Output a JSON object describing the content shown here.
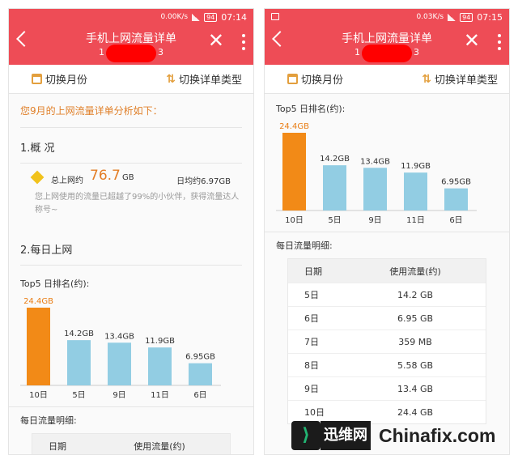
{
  "header": {
    "title": "手机上网流量详单",
    "subtitle_left": "1",
    "subtitle_right": "3",
    "close_glyph": "✕"
  },
  "left_status": {
    "speed": "0.00K/s",
    "battery": "94",
    "time": "07:14"
  },
  "right_status": {
    "speed": "0.03K/s",
    "battery": "94",
    "time": "07:15"
  },
  "toolbar": {
    "switch_month": "切换月份",
    "switch_type": "切换详单类型",
    "swap_glyph": "⇅"
  },
  "analysis_intro": "您9月的上网流量详单分析如下：",
  "overview": {
    "heading": "1.概 况",
    "total_label": "总上网约",
    "total_value": "76.7",
    "total_unit": "GB",
    "daily_avg": "日均约6.97GB",
    "description": "您上网使用的流量已超越了99%的小伙伴，获得流量达人称号~"
  },
  "daily": {
    "heading": "2.每日上网",
    "top5_title": "Top5 日排名(约):",
    "detail_title": "每日流量明细:"
  },
  "chart_data": {
    "type": "bar",
    "title": "Top5 日排名(约):",
    "categories": [
      "10日",
      "5日",
      "9日",
      "11日",
      "6日"
    ],
    "values": [
      24.4,
      14.2,
      13.4,
      11.9,
      6.95
    ],
    "value_labels": [
      "24.4GB",
      "14.2GB",
      "13.4GB",
      "11.9GB",
      "6.95GB"
    ],
    "unit": "GB",
    "colors": [
      "#f28a17",
      "#92cde3",
      "#92cde3",
      "#92cde3",
      "#92cde3"
    ],
    "ylim": [
      0,
      24.4
    ]
  },
  "table": {
    "headers": [
      "日期",
      "使用流量(约)"
    ],
    "rows": [
      [
        "5日",
        "14.2 GB"
      ],
      [
        "6日",
        "6.95 GB"
      ],
      [
        "7日",
        "359 MB"
      ],
      [
        "8日",
        "5.58 GB"
      ],
      [
        "9日",
        "13.4 GB"
      ],
      [
        "10日",
        "24.4 GB"
      ]
    ]
  },
  "watermark": {
    "logo_glyph": "⟩",
    "cn": "迅维网",
    "en": "Chinafix.com"
  }
}
